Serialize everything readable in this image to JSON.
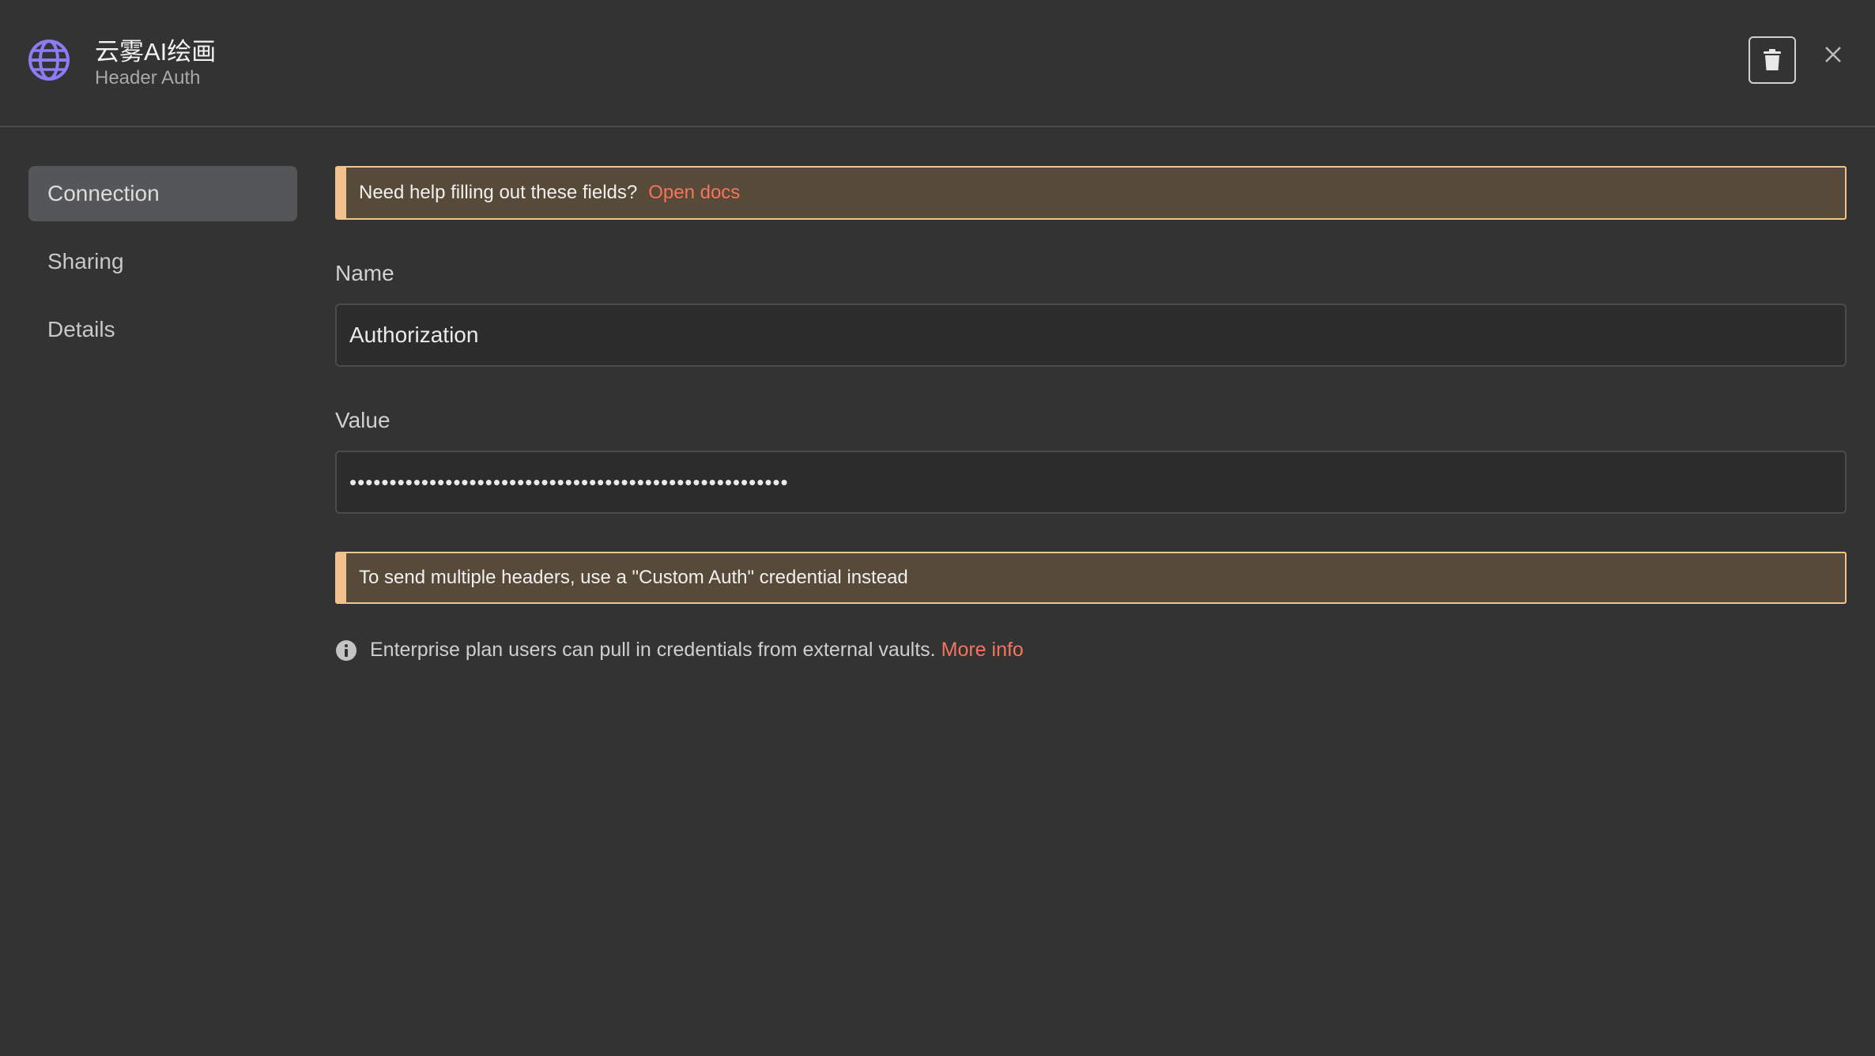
{
  "header": {
    "title": "云雾AI绘画",
    "subtitle": "Header Auth",
    "icon": "globe-icon",
    "delete_icon": "trash-icon",
    "close_icon": "close-icon",
    "accent_color": "#8b7cf6"
  },
  "sidebar": {
    "items": [
      {
        "label": "Connection",
        "active": true
      },
      {
        "label": "Sharing",
        "active": false
      },
      {
        "label": "Details",
        "active": false
      }
    ]
  },
  "main": {
    "help_notice": {
      "text": "Need help filling out these fields?",
      "link": "Open docs"
    },
    "name_field": {
      "label": "Name",
      "value": "Authorization"
    },
    "value_field": {
      "label": "Value",
      "value": "•••••••••••••••••••••••••••••••••••••••••••••••••••••••"
    },
    "multi_header_notice": {
      "text": "To send multiple headers, use a \"Custom Auth\" credential instead"
    },
    "enterprise_info": {
      "text": "Enterprise plan users can pull in credentials from external vaults.",
      "link": "More info"
    }
  },
  "colors": {
    "background": "#333333",
    "notice_bg": "#584a38",
    "notice_border": "#f2c28e",
    "link": "#f4745e"
  }
}
